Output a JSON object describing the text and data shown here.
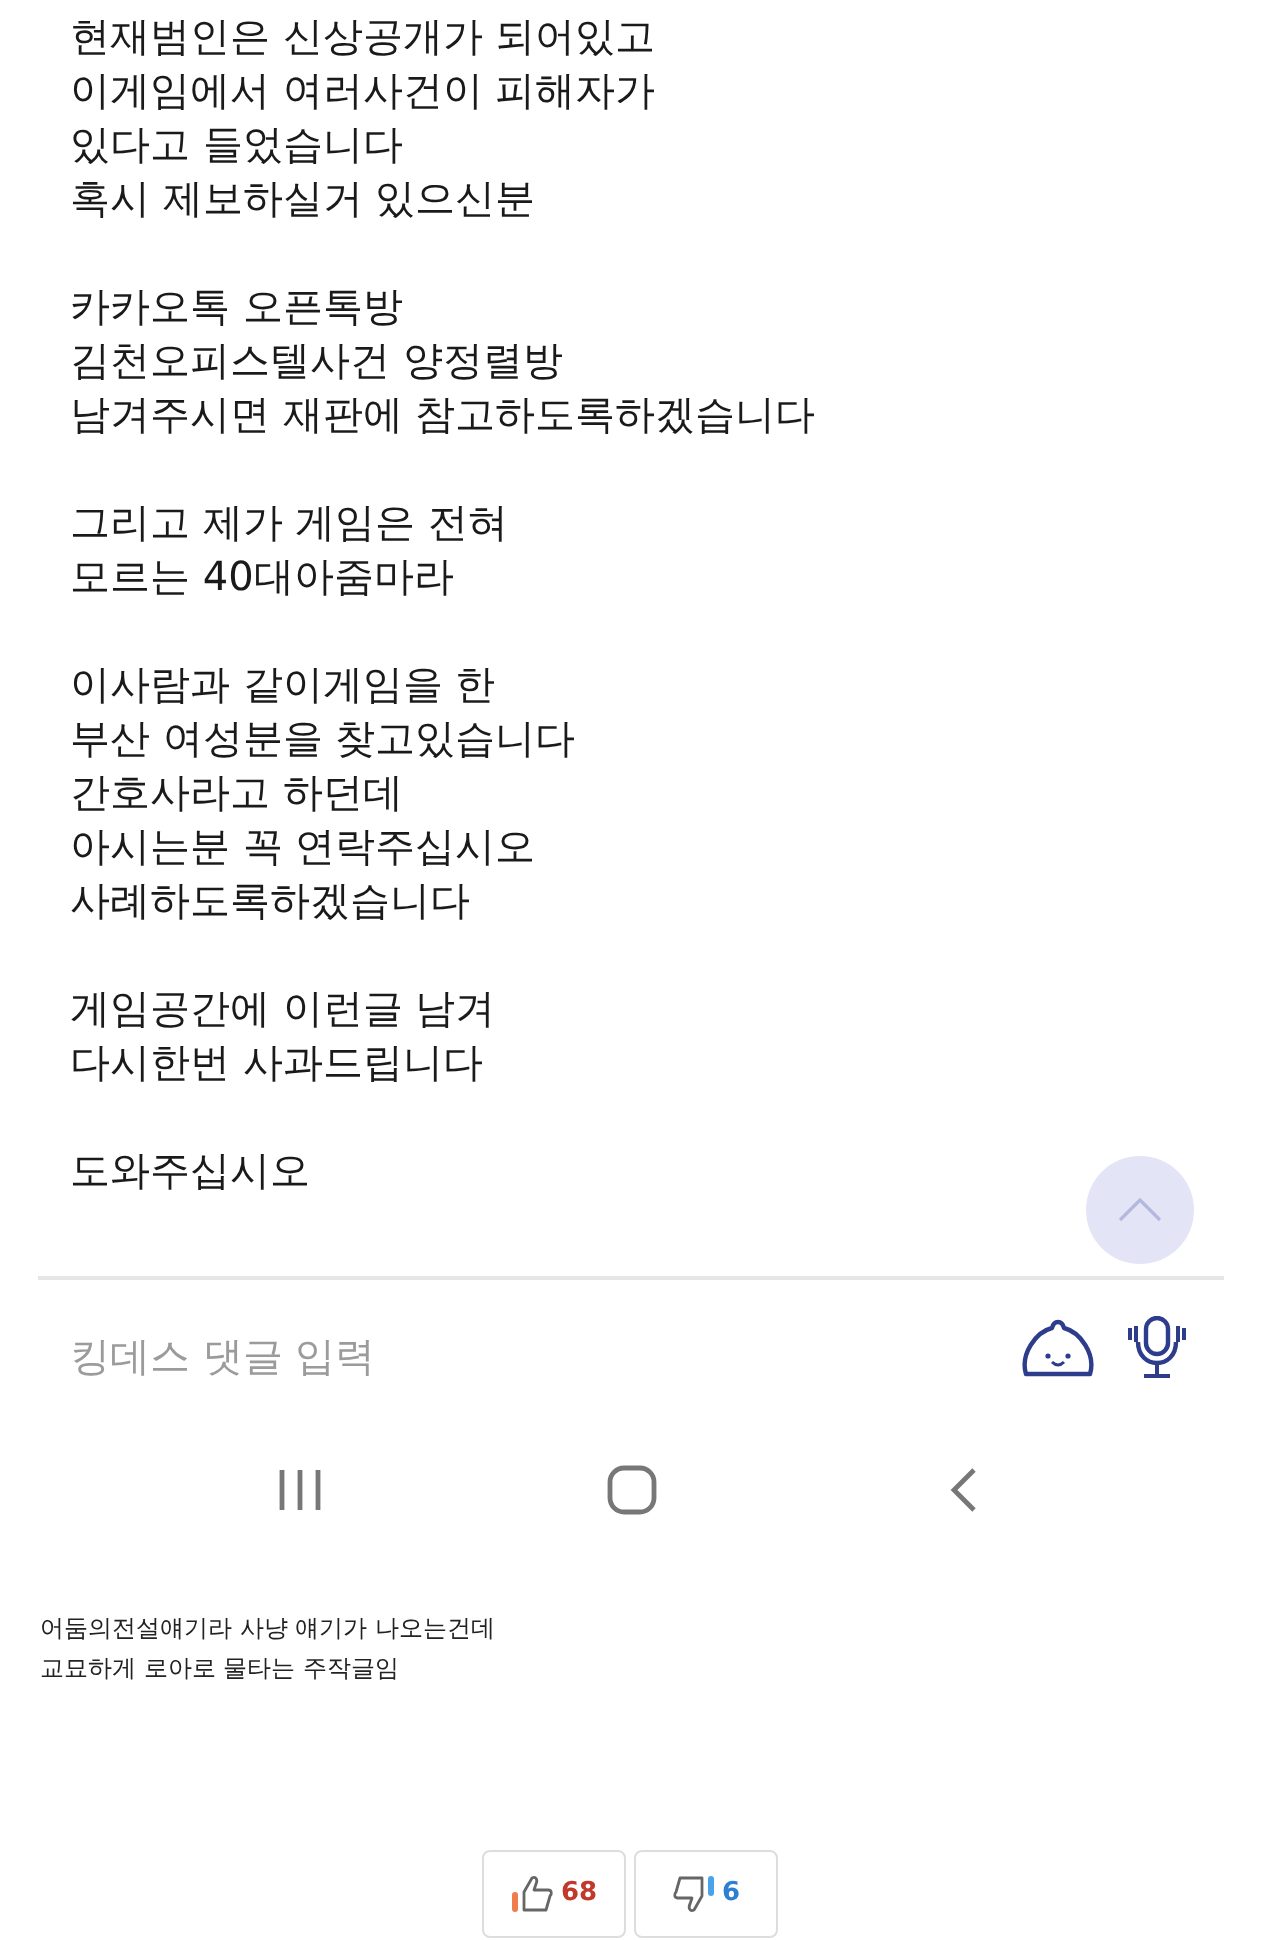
{
  "post": {
    "paragraphs": [
      [
        "현재범인은 신상공개가 되어있고",
        "이게임에서 여러사건이 피해자가",
        "있다고 들었습니다",
        "혹시 제보하실거 있으신분"
      ],
      [
        "카카오톡 오픈톡방",
        "김천오피스텔사건 양정렬방",
        "남겨주시면 재판에 참고하도록하겠습니다"
      ],
      [
        "그리고 제가 게임은 전혀",
        "모르는 40대아줌마라"
      ],
      [
        "이사람과 같이게임을 한",
        "부산 여성분을 찾고있습니다",
        "간호사라고 하던데",
        "아시는분 꼭 연락주십시오",
        "사례하도록하겠습니다"
      ],
      [
        "게임공간에 이런글 남겨",
        "다시한번 사과드립니다"
      ],
      [
        "도와주십시오"
      ]
    ]
  },
  "comment_input": {
    "placeholder": "킹데스 댓글 입력"
  },
  "caption": [
    "어둠의전설얘기라 사냥 얘기가 나오는건데",
    "교묘하게 로아로 물타는 주작글임"
  ],
  "votes": {
    "up": "68",
    "down": "6"
  }
}
